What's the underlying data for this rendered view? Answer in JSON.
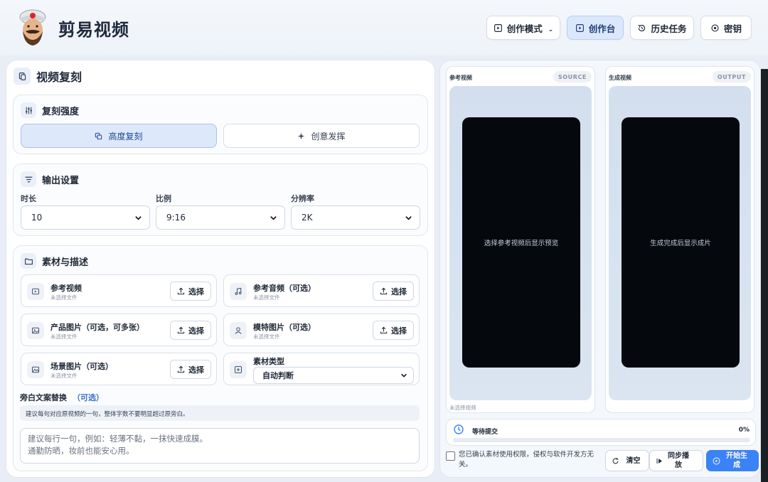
{
  "app": {
    "title": "剪易视频"
  },
  "nav": {
    "mode": "创作模式",
    "workbench": "创作台",
    "history": "历史任务",
    "key": "密钥"
  },
  "left": {
    "title": "视频复刻",
    "strength": {
      "title": "复刻强度",
      "high": "高度复刻",
      "creative": "创意发挥"
    },
    "output": {
      "title": "输出设置",
      "duration_label": "时长",
      "duration_value": "10",
      "ratio_label": "比例",
      "ratio_value": "9:16",
      "resolution_label": "分辨率",
      "resolution_value": "2K"
    },
    "assets": {
      "title": "素材与描述",
      "select_label": "选择",
      "no_file": "未选择文件",
      "ref_video": "参考视频",
      "ref_audio": "参考音频（可选）",
      "product_images": "产品图片（可选，可多张）",
      "model_images": "模特图片（可选）",
      "scene_images": "场景图片（可选）",
      "type_label": "素材类型",
      "type_value": "自动判断"
    },
    "narration": {
      "label": "旁白文案替换",
      "optional": "（可选）",
      "hint": "建议每句对应原视频的一句，整体字数不要明显超过原旁白。",
      "placeholder": "建议每行一句，例如：轻薄不黏，一抹快速成膜。\n通勤防晒，妆前也能安心用。"
    }
  },
  "right": {
    "source": {
      "title": "参考视频",
      "badge": "SOURCE",
      "placeholder": "选择参考视频后显示预览",
      "under": "未选择视频"
    },
    "output": {
      "title": "生成视频",
      "badge": "OUTPUT",
      "placeholder": "生成完成后显示成片"
    },
    "status": {
      "label": "等待提交",
      "percent": "0%",
      "progress": 0
    },
    "consent": "您已确认素材使用权限，侵权与软件开发方无关。",
    "clear": "清空",
    "sync_play": "同步播放",
    "start": "开始生成"
  },
  "colors": {
    "accent": "#3b82f6",
    "active_bg": "#dbe8fb",
    "video_bg": "#05080d"
  }
}
